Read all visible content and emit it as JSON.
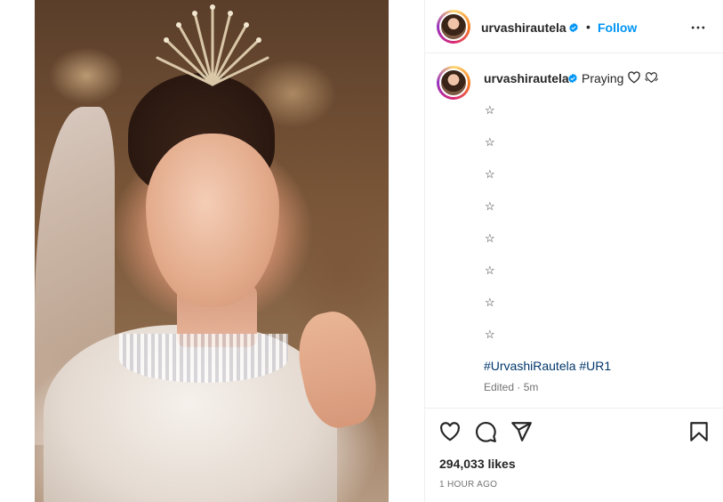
{
  "post": {
    "username": "urvashirautela",
    "follow_label": "Follow",
    "separator": "•",
    "caption_word": "Praying",
    "stars": [
      "☆",
      "☆",
      "☆",
      "☆",
      "☆",
      "☆",
      "☆",
      "☆"
    ],
    "hashtags": [
      "#UrvashiRautela",
      "#UR1"
    ],
    "edited_label": "Edited",
    "meta_separator": "·",
    "edited_time": "5m",
    "likes_text": "294,033 likes",
    "timestamp": "1 HOUR AGO"
  },
  "icons": {
    "verified": "verified-badge-icon",
    "more": "more-options-icon",
    "like": "heart-icon",
    "comment": "comment-icon",
    "share": "share-icon",
    "save": "bookmark-icon",
    "caption_heart": "heart-outline-icon",
    "caption_hands": "heart-hands-icon"
  },
  "colors": {
    "accent": "#0095f6",
    "verified": "#0095f6",
    "hashtag": "#00376b",
    "muted": "#737373"
  }
}
